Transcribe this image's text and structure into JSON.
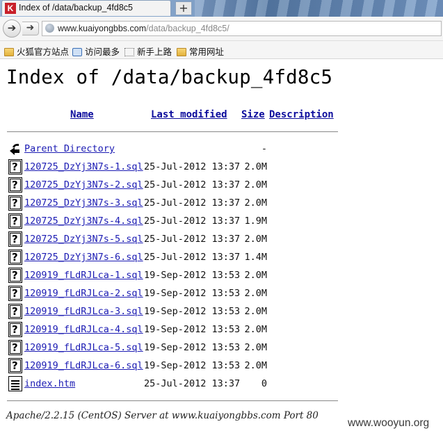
{
  "browser": {
    "tab_title": "Index of /data/backup_4fd8c5",
    "favicon_letter": "K",
    "new_tab_symbol": "+",
    "url_host": "www.kuaiyongbbs.com",
    "url_path": "/data/backup_4fd8c5/",
    "bookmarks": [
      {
        "label": "火狐官方站点",
        "icon": "folder-icon"
      },
      {
        "label": "访问最多",
        "icon": "search-bookmark-icon"
      },
      {
        "label": "新手上路",
        "icon": "dotted-page-icon"
      },
      {
        "label": "常用网址",
        "icon": "folder-icon"
      }
    ]
  },
  "page": {
    "title": "Index of /data/backup_4fd8c5",
    "columns": {
      "name": "Name",
      "modified": "Last modified",
      "size": "Size",
      "description": "Description"
    },
    "parent": {
      "name": "Parent Directory",
      "size": "-"
    },
    "files": [
      {
        "name": "120725_DzYj3N7s-1.sql",
        "modified": "25-Jul-2012 13:37",
        "size": "2.0M",
        "icon": "unknown-file-icon"
      },
      {
        "name": "120725_DzYj3N7s-2.sql",
        "modified": "25-Jul-2012 13:37",
        "size": "2.0M",
        "icon": "unknown-file-icon"
      },
      {
        "name": "120725_DzYj3N7s-3.sql",
        "modified": "25-Jul-2012 13:37",
        "size": "2.0M",
        "icon": "unknown-file-icon"
      },
      {
        "name": "120725_DzYj3N7s-4.sql",
        "modified": "25-Jul-2012 13:37",
        "size": "1.9M",
        "icon": "unknown-file-icon"
      },
      {
        "name": "120725_DzYj3N7s-5.sql",
        "modified": "25-Jul-2012 13:37",
        "size": "2.0M",
        "icon": "unknown-file-icon"
      },
      {
        "name": "120725_DzYj3N7s-6.sql",
        "modified": "25-Jul-2012 13:37",
        "size": "1.4M",
        "icon": "unknown-file-icon"
      },
      {
        "name": "120919_fLdRJLca-1.sql",
        "modified": "19-Sep-2012 13:53",
        "size": "2.0M",
        "icon": "unknown-file-icon"
      },
      {
        "name": "120919_fLdRJLca-2.sql",
        "modified": "19-Sep-2012 13:53",
        "size": "2.0M",
        "icon": "unknown-file-icon"
      },
      {
        "name": "120919_fLdRJLca-3.sql",
        "modified": "19-Sep-2012 13:53",
        "size": "2.0M",
        "icon": "unknown-file-icon"
      },
      {
        "name": "120919_fLdRJLca-4.sql",
        "modified": "19-Sep-2012 13:53",
        "size": "2.0M",
        "icon": "unknown-file-icon"
      },
      {
        "name": "120919_fLdRJLca-5.sql",
        "modified": "19-Sep-2012 13:53",
        "size": "2.0M",
        "icon": "unknown-file-icon"
      },
      {
        "name": "120919_fLdRJLca-6.sql",
        "modified": "19-Sep-2012 13:53",
        "size": "2.0M",
        "icon": "unknown-file-icon"
      },
      {
        "name": "index.htm",
        "modified": "25-Jul-2012 13:37",
        "size": "0",
        "icon": "text-file-icon"
      }
    ],
    "address": "Apache/2.2.15 (CentOS) Server at www.kuaiyongbbs.com Port 80"
  },
  "watermark": "www.wooyun.org",
  "colors": {
    "link": "#1b1bb3",
    "header_link": "#0b0b9c",
    "favicon_bg": "#c8202a"
  }
}
